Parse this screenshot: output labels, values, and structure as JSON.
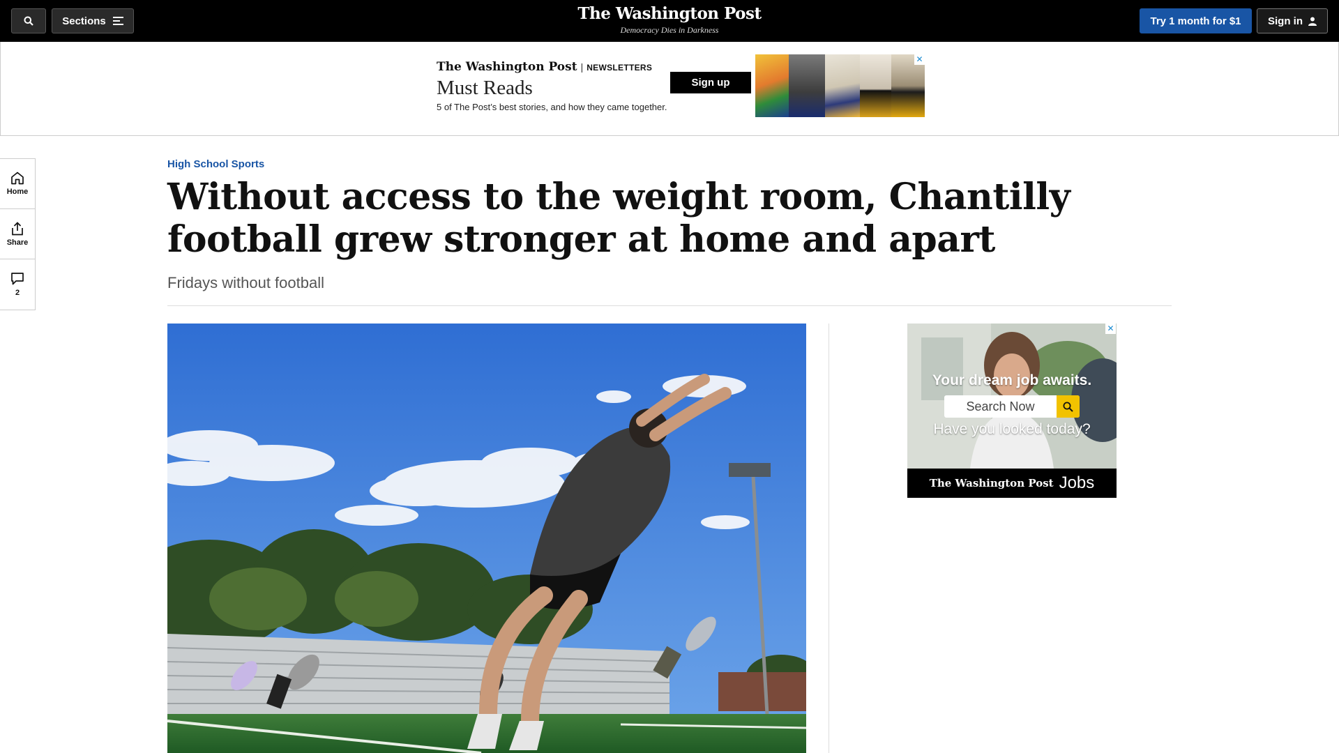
{
  "topbar": {
    "sections_label": "Sections",
    "masthead_title": "The Washington Post",
    "masthead_tagline": "Democracy Dies in Darkness",
    "trial_label": "Try 1 month for $1",
    "sign_in_label": "Sign in",
    "trial_color": "#1955a5",
    "icons": [
      "search-icon",
      "hamburger-menu-icon",
      "user-icon"
    ]
  },
  "newsletter_ad": {
    "brand": "The Washington Post",
    "brand_tag": "NEWSLETTERS",
    "title": "Must Reads",
    "subtitle": "5 of The Post’s best stories, and how they came together.",
    "cta_label": "Sign up",
    "close_icon": "close-icon"
  },
  "left_rail": {
    "items": [
      {
        "label": "Home",
        "icon": "home-icon"
      },
      {
        "label": "Share",
        "icon": "share-icon"
      },
      {
        "label": "2",
        "icon": "comment-icon"
      }
    ]
  },
  "article": {
    "kicker": "High School Sports",
    "headline": "Without access to the weight room, Chantilly football grew stronger at home and apart",
    "dek": "Fridays without football",
    "kicker_color": "#1955a5"
  },
  "jobs_ad": {
    "headline": "Your dream job awaits.",
    "search_label": "Search Now",
    "question": "Have you looked today?",
    "footer_brand": "The Washington Post",
    "footer_product": "Jobs",
    "accent_color": "#f2c200"
  }
}
